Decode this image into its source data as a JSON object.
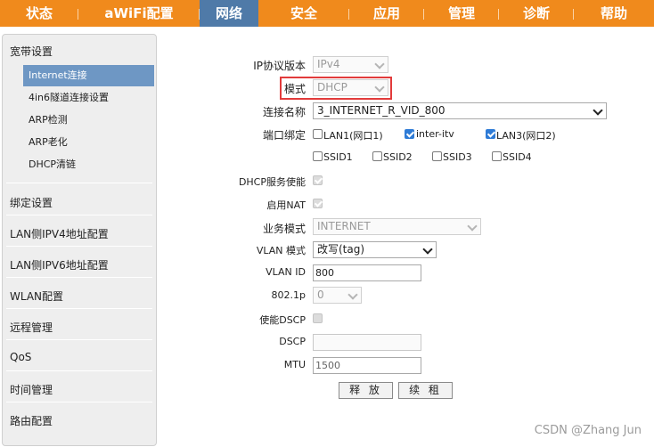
{
  "nav": {
    "tabs": [
      "状态",
      "aWiFi配置",
      "网络",
      "安全",
      "应用",
      "管理",
      "诊断",
      "帮助"
    ],
    "active": "网络"
  },
  "sidebar": {
    "section1": "宽带设置",
    "subitems": [
      "Internet连接",
      "4in6隧道连接设置",
      "ARP检测",
      "ARP老化",
      "DHCP清链"
    ],
    "sections": [
      "绑定设置",
      "LAN侧IPV4地址配置",
      "LAN侧IPV6地址配置",
      "WLAN配置",
      "远程管理",
      "QoS",
      "时间管理",
      "路由配置"
    ]
  },
  "form": {
    "ip_version_label": "IP协议版本",
    "ip_version_value": "IPv4",
    "mode_label": "模式",
    "mode_value": "DHCP",
    "conn_name_label": "连接名称",
    "conn_name_value": "3_INTERNET_R_VID_800",
    "port_bind_label": "端口绑定",
    "ports": [
      {
        "label": "LAN1(网口1)",
        "checked": false
      },
      {
        "label": "inter-itv",
        "checked": true
      },
      {
        "label": "LAN3(网口2)",
        "checked": true
      },
      {
        "label": "SSID1",
        "checked": false
      },
      {
        "label": "SSID2",
        "checked": false
      },
      {
        "label": "SSID3",
        "checked": false
      },
      {
        "label": "SSID4",
        "checked": false
      }
    ],
    "dhcp_server_label": "DHCP服务使能",
    "nat_label": "启用NAT",
    "service_mode_label": "业务模式",
    "service_mode_value": "INTERNET",
    "vlan_mode_label": "VLAN 模式",
    "vlan_mode_value": "改写(tag)",
    "vlan_id_label": "VLAN ID",
    "vlan_id_value": "800",
    "dot1p_label": "802.1p",
    "dot1p_value": "0",
    "dscp_enable_label": "使能DSCP",
    "dscp_label": "DSCP",
    "dscp_value": "",
    "mtu_label": "MTU",
    "mtu_value": "1500",
    "release_button": "释 放",
    "renew_button": "续 租"
  },
  "watermark": "CSDN @Zhang Jun"
}
